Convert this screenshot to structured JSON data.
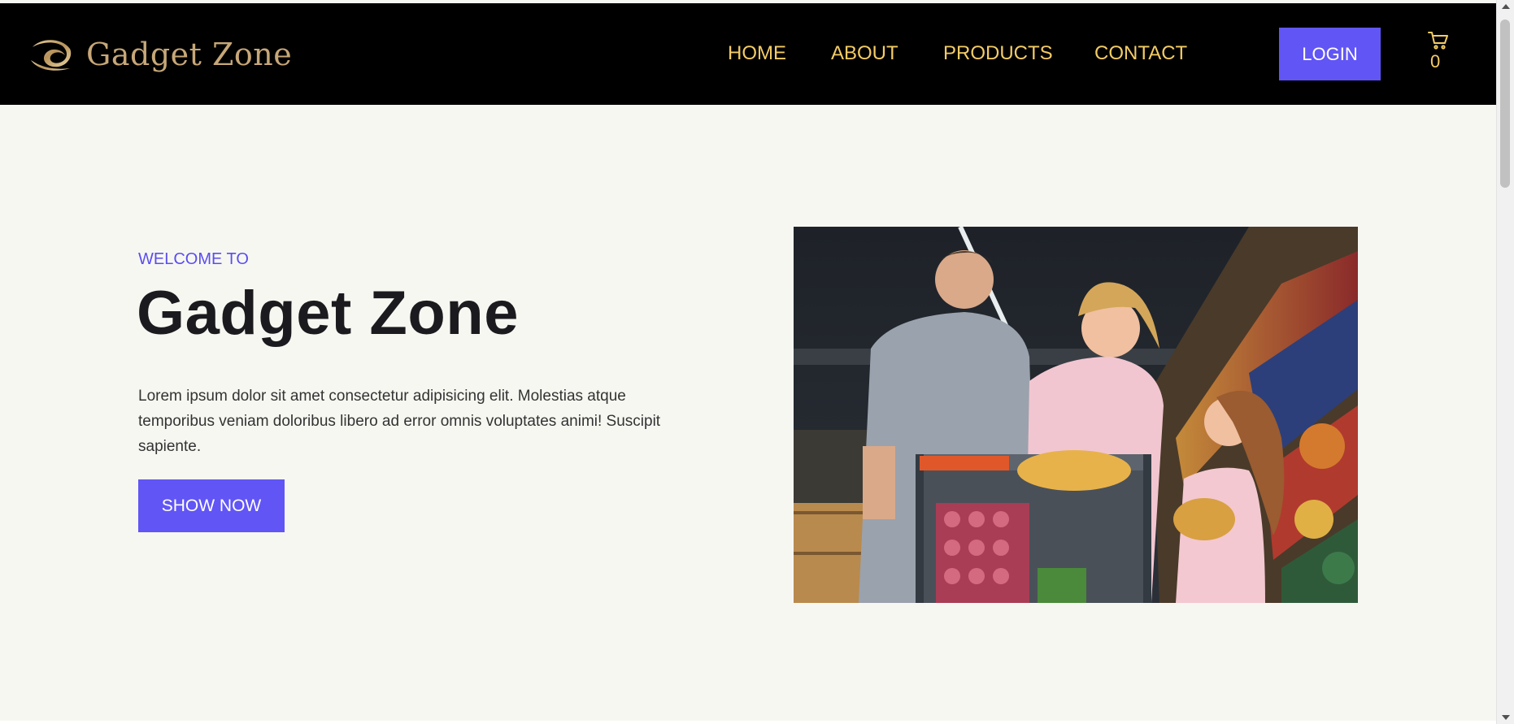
{
  "brand": {
    "name": "Gadget Zone",
    "logo_color": "#c7a778"
  },
  "nav": {
    "items": [
      {
        "label": "HOME"
      },
      {
        "label": "ABOUT"
      },
      {
        "label": "PRODUCTS"
      },
      {
        "label": "CONTACT"
      }
    ],
    "link_color": "#f4cc66"
  },
  "header": {
    "login_label": "LOGIN",
    "cart_icon": "shopping-cart-icon",
    "cart_count": "0"
  },
  "hero": {
    "eyebrow": "WELCOME TO",
    "title": "Gadget Zone",
    "text": "Lorem ipsum dolor sit amet consectetur adipisicing elit. Molestias atque temporibus veniam doloribus libero ad error omnis voluptates animi! Suscipit sapiente.",
    "cta_label": "SHOW NOW",
    "image_icon": "family-shopping-photo"
  },
  "colors": {
    "accent": "#6155f5",
    "header_bg": "#000000",
    "page_bg": "#f7f7f2",
    "title": "#1b1b1f"
  }
}
